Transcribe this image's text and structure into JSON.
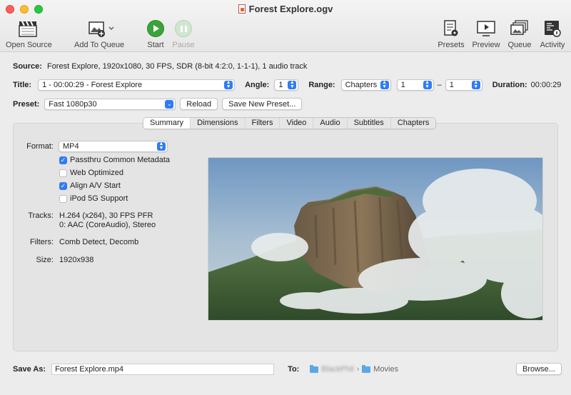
{
  "window": {
    "title": "Forest Explore.ogv"
  },
  "toolbar": {
    "open_source": "Open Source",
    "add_to_queue": "Add To Queue",
    "start": "Start",
    "pause": "Pause",
    "presets": "Presets",
    "preview": "Preview",
    "queue": "Queue",
    "activity": "Activity"
  },
  "source": {
    "label": "Source:",
    "value": "Forest Explore, 1920x1080, 30 FPS, SDR (8-bit 4:2:0, 1-1-1), 1 audio track"
  },
  "title_row": {
    "title_label": "Title:",
    "title_value": "1 - 00:00:29 - Forest Explore",
    "angle_label": "Angle:",
    "angle_value": "1",
    "range_label": "Range:",
    "range_type": "Chapters",
    "range_start": "1",
    "range_sep": "–",
    "range_end": "1",
    "duration_label": "Duration:",
    "duration_value": "00:00:29"
  },
  "preset_row": {
    "label": "Preset:",
    "value": "Fast 1080p30",
    "reload": "Reload",
    "save_new": "Save New Preset..."
  },
  "tabs": [
    "Summary",
    "Dimensions",
    "Filters",
    "Video",
    "Audio",
    "Subtitles",
    "Chapters"
  ],
  "active_tab": "Summary",
  "summary": {
    "format_label": "Format:",
    "format_value": "MP4",
    "options": [
      {
        "label": "Passthru Common Metadata",
        "checked": true
      },
      {
        "label": "Web Optimized",
        "checked": false
      },
      {
        "label": "Align A/V Start",
        "checked": true
      },
      {
        "label": "iPod 5G Support",
        "checked": false
      }
    ],
    "tracks_label": "Tracks:",
    "tracks_line1": "H.264 (x264), 30 FPS PFR",
    "tracks_line2": "0: AAC (CoreAudio), Stereo",
    "filters_label": "Filters:",
    "filters_value": "Comb Detect, Decomb",
    "size_label": "Size:",
    "size_value": "1920x938"
  },
  "save": {
    "label": "Save As:",
    "filename": "Forest Explore.mp4",
    "to_label": "To:",
    "path_user": "BlackPhil",
    "path_folder": "Movies",
    "browse": "Browse..."
  },
  "colors": {
    "accent": "#2f7cf6",
    "start_green": "#3aa43a"
  }
}
